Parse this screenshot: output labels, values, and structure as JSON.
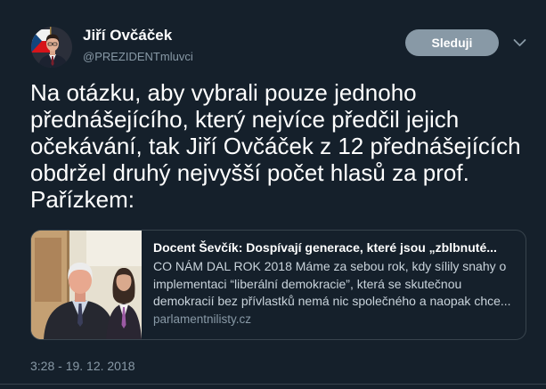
{
  "colors": {
    "background": "#15202b",
    "text": "#ffffff",
    "secondary_text": "#8899a6",
    "card_description": "#c9d3db",
    "border": "#38444d",
    "follow_button": "#8899a6"
  },
  "author": {
    "name": "Jiří Ovčáček",
    "handle": "@PREZIDENTmluvci",
    "avatar_icon": "profile-photo"
  },
  "follow_button": {
    "label": "Sleduji"
  },
  "menu_icon": "chevron-down-icon",
  "tweet": {
    "lines": [
      "Na otázku, aby vybrali pouze jednoho",
      "přednášejícího, který nejvíce předčil jejich",
      "očekávání, tak Jiří Ovčáček z 12 přednášejících",
      "obdržel druhý nejvyšší počet hlasů za prof.",
      "Pařízkem:"
    ]
  },
  "card": {
    "image_icon": "news-photo",
    "title": "Docent Ševčík: Dospívají generace, které jsou „zblbnuté...",
    "description_lines": [
      "CO NÁM DAL ROK 2018 Máme za sebou rok, kdy sílily snahy o",
      "implementaci “liberální demokracie”, která se skutečnou",
      "demokracií bez přívlastků nemá nic společného a naopak chce..."
    ],
    "domain": "parlamentnilisty.cz"
  },
  "timestamp": "3:28 - 19. 12. 2018"
}
